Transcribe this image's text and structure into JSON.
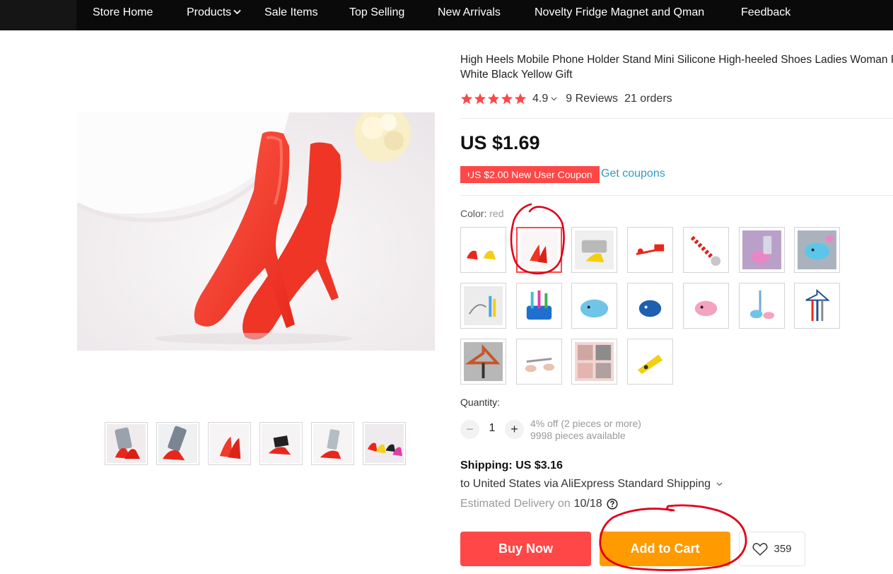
{
  "nav": {
    "items": [
      "Store Home",
      "Products",
      "Sale Items",
      "Top Selling",
      "New Arrivals",
      "Novelty Fridge Magnet and Qman",
      "Feedback"
    ]
  },
  "product": {
    "title": "High Heels Mobile Phone Holder Stand Mini Silicone High-heeled Shoes Ladies Woman Red White Black Yellow Gift",
    "rating": "4.9",
    "rating_stars": 5,
    "reviews": "9 Reviews",
    "orders": "21 orders",
    "price": "US $1.69",
    "coupon": "US $2.00 New User Coupon",
    "get_coupons": "Get coupons"
  },
  "color": {
    "label": "Color:",
    "value": "red",
    "selected_index": 1,
    "swatch_count": 18
  },
  "quantity": {
    "label": "Quantity:",
    "value": "1",
    "minus": "−",
    "plus": "+",
    "discount": "4% off (2 pieces or more)",
    "available": "9998 pieces available"
  },
  "shipping": {
    "line1": "Shipping: US $3.16",
    "line2": "to United States via AliExpress Standard Shipping",
    "eta_label": "Estimated Delivery on",
    "eta_date": "10/18"
  },
  "actions": {
    "buy_now": "Buy Now",
    "add_to_cart": "Add to Cart",
    "wishlist_count": "359"
  },
  "colors": {
    "accent_red": "#ff4747",
    "accent_orange": "#ff9a00",
    "link_blue": "#2e9cc3",
    "star": "#ff4747",
    "nav_bg": "#0a0a0a",
    "annotation": "#e0001b"
  }
}
